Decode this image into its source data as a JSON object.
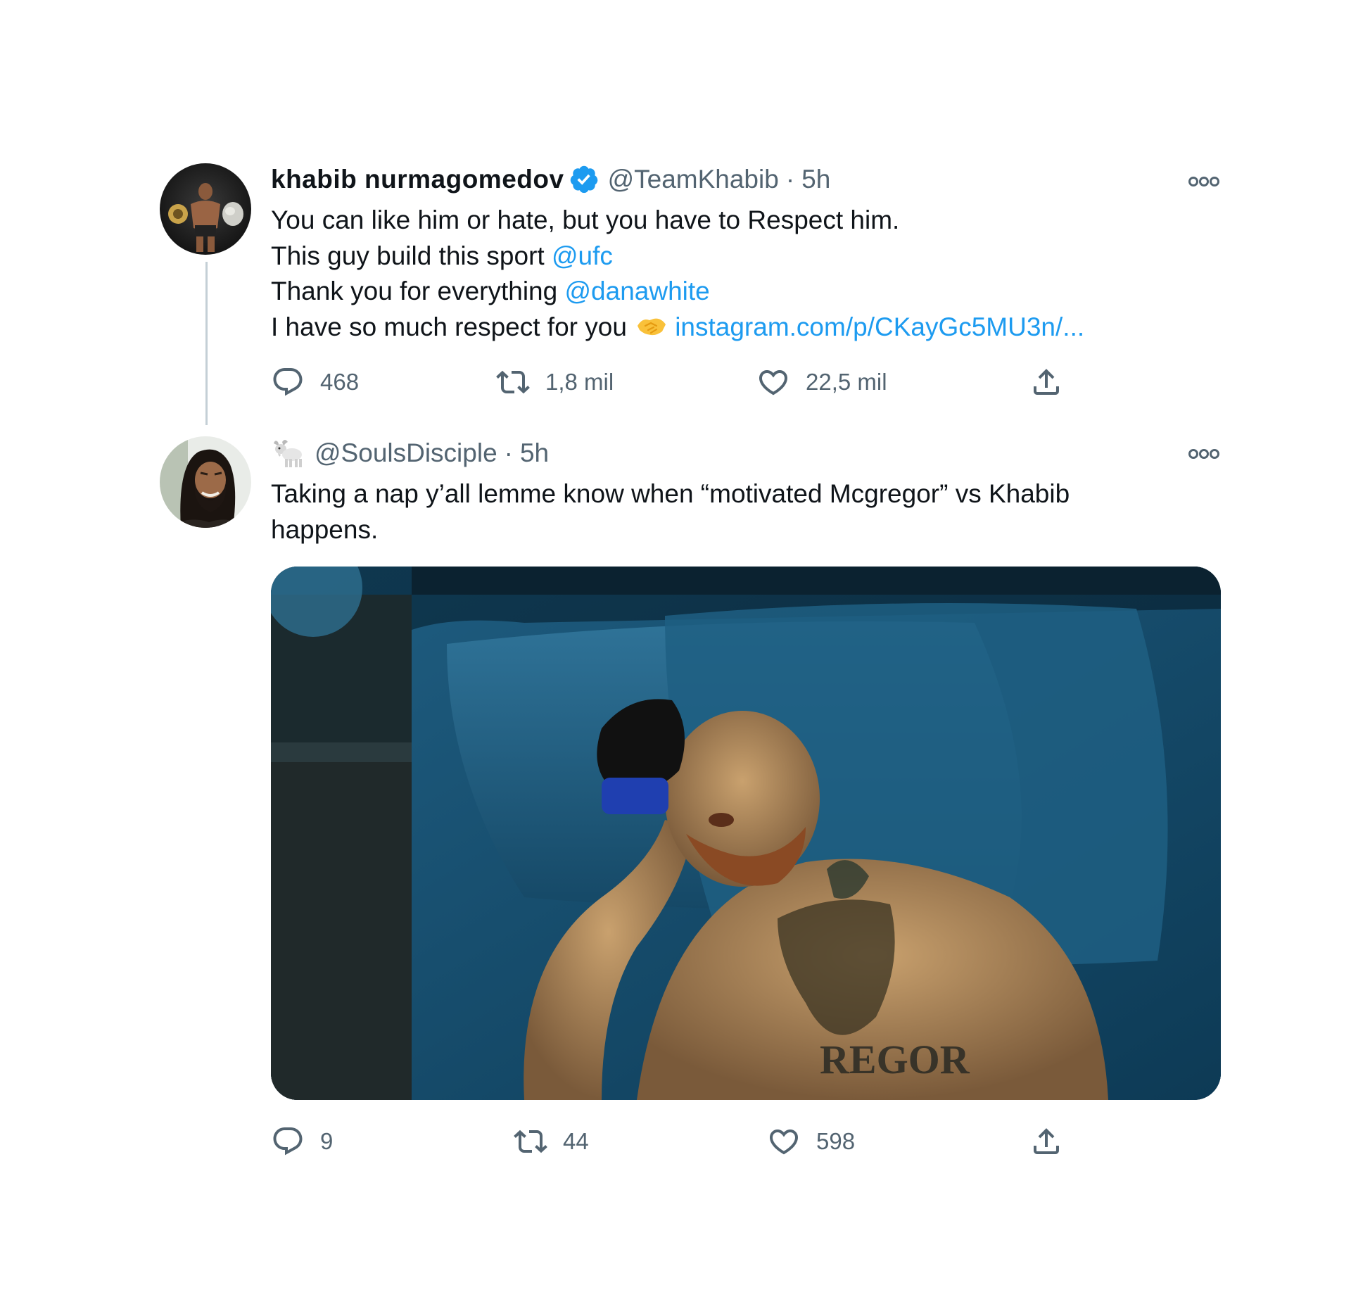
{
  "tweets": [
    {
      "name": "khabib nurmagomedov",
      "verified": true,
      "handle": "@TeamKhabib",
      "separator": "·",
      "time": "5h",
      "lines": {
        "l1": "You can like him or hate, but you have to Respect him.",
        "l2_text": "This guy build this sport ",
        "l2_mention": "@ufc",
        "l3_text": "Thank you for everything ",
        "l3_mention": "@danawhite",
        "l4_text": "I have so much respect for you",
        "l4_link": "instagram.com/p/CKayGc5MU3n/..."
      },
      "stats": {
        "replies": "468",
        "retweets": "1,8 mil",
        "likes": "22,5 mil"
      }
    },
    {
      "handle": "@SoulsDisciple",
      "separator": "·",
      "time": "5h",
      "lines": {
        "l1": "Taking a nap y’all lemme know when “motivated Mcgregor” vs Khabib",
        "l2": "happens."
      },
      "media_watermark": "REGOR",
      "stats": {
        "replies": "9",
        "retweets": "44",
        "likes": "598"
      }
    }
  ],
  "icons": {
    "reply": "reply-icon",
    "retweet": "retweet-icon",
    "like": "heart-icon",
    "share": "share-icon",
    "more": "more-icon",
    "verified": "verified-badge-icon",
    "goat_emoji": "goat-emoji-icon",
    "handshake_emoji": "handshake-emoji-icon"
  },
  "colors": {
    "text": "#0f1419",
    "secondary": "#536471",
    "link": "#1d9bf0",
    "thread_line": "#c4cfd6"
  }
}
